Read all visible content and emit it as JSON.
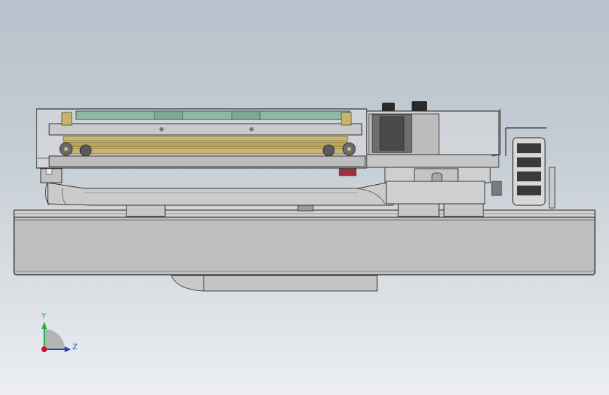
{
  "viewport": {
    "view_name": "side-view"
  },
  "triad": {
    "y_label": "Y",
    "z_label": "Z",
    "y_color": "#22b14c",
    "z_color": "#1f3fbf",
    "x_color": "#c8102e"
  },
  "colors": {
    "metal_gray": "#c0c0c0",
    "dark_edge": "#2a2a2a",
    "glass_cover": "#dcdcde",
    "brass": "#c8b46a",
    "teal_plate": "#8fb8a4"
  }
}
